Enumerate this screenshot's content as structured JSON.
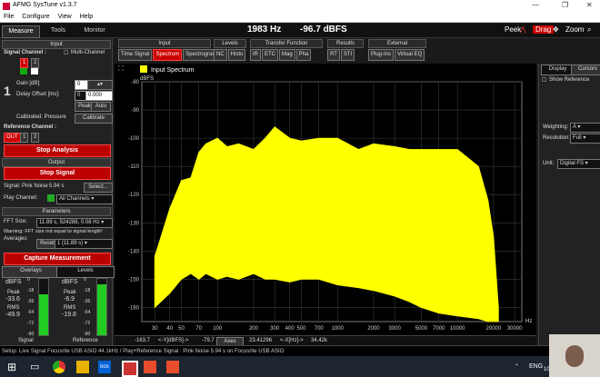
{
  "window": {
    "title": "AFMG SysTune v1.3.7",
    "min": "—",
    "max": "❐",
    "close": "✕"
  },
  "menu": [
    "File",
    "Configure",
    "View",
    "Help"
  ],
  "topbar": {
    "tabs": [
      "Measure",
      "Tools",
      "Monitor"
    ],
    "frequency": "1983 Hz",
    "level": "-96.7 dBFS",
    "peak": "Peek",
    "drag": "Drag",
    "zoom": "Zoom"
  },
  "input": {
    "header": "Input",
    "signal_channel": "Signal Channel :",
    "multi_channel": "Multi-Channel",
    "channels": [
      "1",
      "2"
    ],
    "gain_label": "Gain [dB]:",
    "gain_value": "0",
    "delay_label": "Delay Offset [ms]:",
    "delay_value": "0.000",
    "peak_btn": "Peak",
    "auto_btn": "Auto",
    "calibrated": "Calibrated: Pressure",
    "calibrate_btn": "Calibrate",
    "reference_channel": "Reference Channel :",
    "ref_out": "OUT",
    "ref_channels": [
      "1",
      "2"
    ],
    "channel_number": "1"
  },
  "stop_analysis": "Stop Analysis",
  "output": {
    "header": "Output",
    "stop_signal": "Stop Signal",
    "signal_label": "Signal: Pink Noise",
    "signal_time": "5.94 s",
    "select_btn": "Select...",
    "play_channel": "Play Channel:",
    "play_value": "All Channels"
  },
  "parameters": {
    "header": "Parameters",
    "fft_size": "FFT Size:",
    "fft_value": "11.89 s, 524288, 0.08 Hz",
    "warning": "Warning: FFT size not equal to signal length!",
    "averages": "Averages:",
    "reset_btn": "Reset",
    "avg_value": "1 (11.89 s)"
  },
  "capture": "Capture Measurement",
  "bottomtabs": [
    "Overlays",
    "Levels"
  ],
  "meters": {
    "signal": {
      "unit": "dBFS",
      "peak_label": "Peak",
      "peak": "-33.6",
      "rms_label": "RMS",
      "rms": "-49.9",
      "name": "Signal",
      "level": 0.72
    },
    "reference": {
      "unit": "dBFS",
      "peak_label": "Peak",
      "peak": "-6.9",
      "rms_label": "RMS",
      "rms": "-19.8",
      "name": "Reference",
      "level": 0.9
    },
    "scale": [
      "0",
      "-18",
      "-36",
      "-54",
      "-72",
      "-90"
    ]
  },
  "toolbar": {
    "input": {
      "header": "Input",
      "buttons": [
        "Time Signal",
        "Spectrum",
        "Spectrogram"
      ]
    },
    "levels": {
      "header": "Levels",
      "buttons": [
        "NC",
        "Histo"
      ]
    },
    "transfer": {
      "header": "Transfer Function",
      "buttons": [
        "IR",
        "ETC",
        "Mag",
        "Pha"
      ]
    },
    "results": {
      "header": "Results",
      "buttons": [
        "RT",
        "STI"
      ]
    },
    "external": {
      "header": "External",
      "buttons": [
        "Plug-Ins",
        "Virtual EQ"
      ]
    }
  },
  "rightpanel": {
    "tabs": [
      "Display",
      "Cursors"
    ],
    "show_reference": "Show Reference",
    "weighting_label": "Weighting:",
    "weighting": "A",
    "resolution_label": "Resolution:",
    "resolution": "Full",
    "unit_label": "Unit:",
    "unit": "Digital FS"
  },
  "chart_footer": {
    "left_val": "-163.7",
    "ylabel": "<-Y[dBFS]->",
    "right_val": "-79.7",
    "axes": "Axes",
    "x_min": "23.41296",
    "xlabel": "<-X[Hz]->",
    "x_max": "34.42k"
  },
  "statusbar": "Setup: Live Signal Focusrite USB ASIO 44.1kHz / Play+Reference Signal : Pink Noise 5.94 s on Focusrite USB ASIO",
  "taskbar": {
    "lang": "ENG",
    "time": "10:"
  },
  "colors": {
    "accent": "#cc0000",
    "spectrum": "#ffff00"
  },
  "chart_data": {
    "type": "area",
    "legend": [
      "Input Spectrum"
    ],
    "ylabel": "dBFS",
    "xlabel": "Hz",
    "ylim": [
      -165,
      -80
    ],
    "xlim": [
      23.41,
      34420
    ],
    "xscale": "log",
    "yticks": [
      -80,
      -90,
      -100,
      -110,
      -120,
      -130,
      -140,
      -150,
      -160
    ],
    "xticks": [
      30,
      40,
      50,
      70,
      100,
      200,
      300,
      400,
      500,
      700,
      1000,
      2000,
      3000,
      5000,
      7000,
      10000,
      20000,
      30000
    ],
    "xticklabels": [
      "30",
      "40",
      "50",
      "70",
      "100",
      "200",
      "300",
      "400",
      "500",
      "700",
      "1000",
      "2000",
      "3000",
      "5000",
      "7000",
      "10000",
      "20000",
      "30000"
    ],
    "series": [
      {
        "name": "Input Spectrum",
        "x": [
          30,
          40,
          50,
          60,
          70,
          80,
          100,
          120,
          150,
          200,
          250,
          300,
          400,
          500,
          700,
          1000,
          1500,
          2000,
          3000,
          4000,
          5000,
          7000,
          10000,
          15000,
          18000,
          20000,
          22000
        ],
        "top": [
          -142,
          -125,
          -115,
          -114,
          -105,
          -102,
          -100,
          -103,
          -102,
          -104,
          -100,
          -96,
          -100,
          -101,
          -100,
          -100,
          -104,
          -102,
          -103,
          -104,
          -104,
          -104,
          -104,
          -110,
          -122,
          -135,
          -160
        ],
        "bottom": [
          -160,
          -155,
          -150,
          -148,
          -150,
          -148,
          -150,
          -149,
          -150,
          -148,
          -150,
          -150,
          -151,
          -150,
          -150,
          -152,
          -153,
          -154,
          -156,
          -158,
          -160,
          -162,
          -163,
          -164,
          -165,
          -165,
          -165
        ]
      }
    ]
  }
}
